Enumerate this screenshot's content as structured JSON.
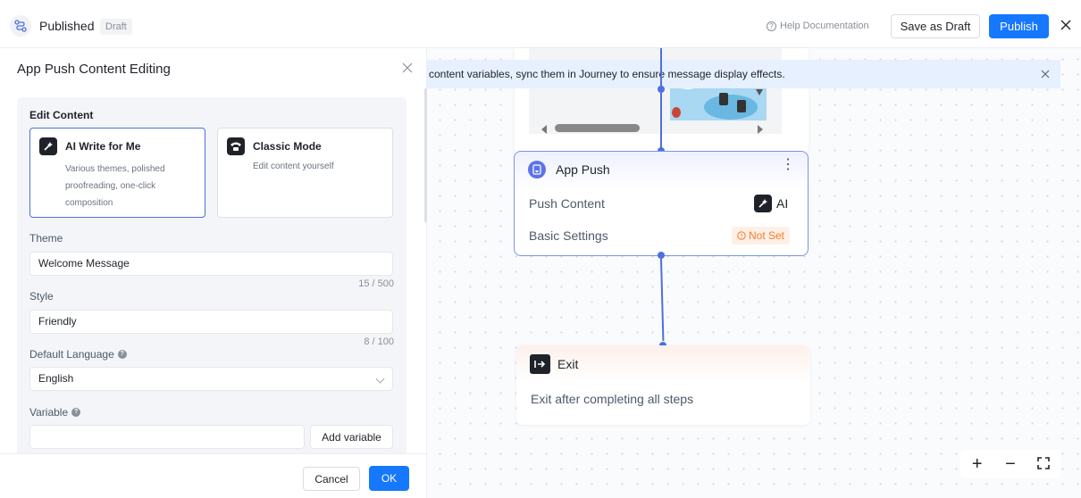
{
  "header": {
    "title": "Published",
    "badge": "Draft",
    "help_label": "Help Documentation",
    "save_draft_label": "Save as Draft",
    "publish_label": "Publish"
  },
  "canvas": {
    "notice_text": "content variables, sync them in Journey to ensure message display effects.",
    "push_node": {
      "title": "App Push",
      "row_push_content": "Push Content",
      "ai_label": "AI",
      "row_basic_settings": "Basic Settings",
      "not_set_label": "Not Set"
    },
    "exit_node": {
      "title": "Exit",
      "description": "Exit after completing all steps"
    }
  },
  "panel": {
    "title": "App Push Content Editing",
    "section_title": "Edit Content",
    "modes": [
      {
        "title": "AI Write for Me",
        "description": "Various themes, polished proofreading, one-click composition",
        "selected": true
      },
      {
        "title": "Classic Mode",
        "description": "Edit content yourself",
        "selected": false
      }
    ],
    "theme": {
      "label": "Theme",
      "value": "Welcome Message",
      "counter": "15 / 500"
    },
    "style": {
      "label": "Style",
      "value": "Friendly",
      "counter": "8 / 100"
    },
    "language": {
      "label": "Default Language",
      "value": "English"
    },
    "variable": {
      "label": "Variable",
      "value": "",
      "add_label": "Add variable"
    },
    "cancel_label": "Cancel",
    "ok_label": "OK"
  },
  "colors": {
    "primary": "#1677ff",
    "node_accent": "#4d6fe0",
    "warning": "#f57b2a"
  }
}
